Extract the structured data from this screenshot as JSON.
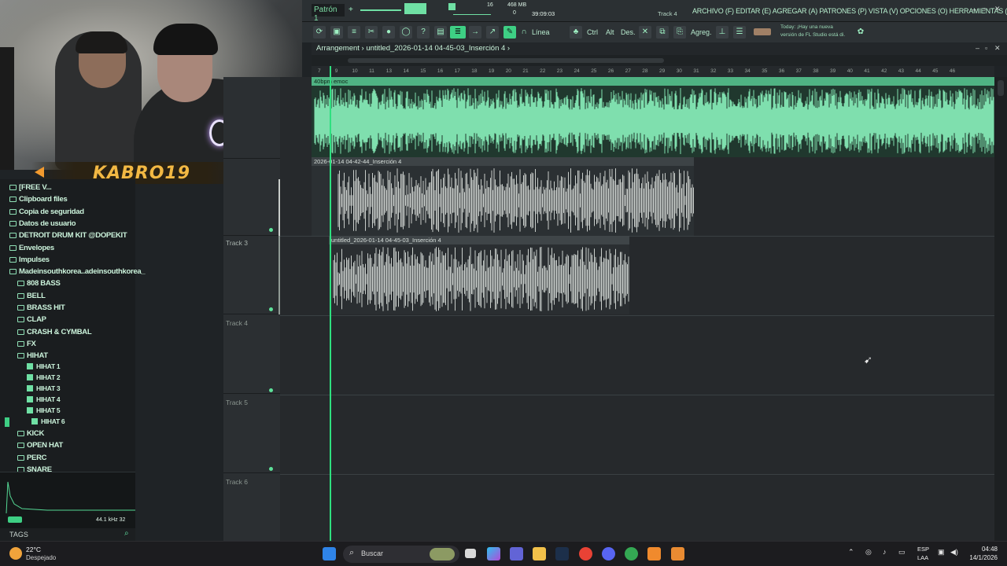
{
  "stream": {
    "name": "KABRO19"
  },
  "fl": {
    "pattern": "Patrón 1",
    "cpu_top": "16",
    "memory": "468 MB",
    "cpu_bottom": "0",
    "time": "39:09:03",
    "hint": "Track 4",
    "menu": "ARCHIVO (F) EDITAR (E) AGREGAR (A) PATRONES (P) VISTA (V) OPCIONES (O) HERRAMIENTAS (T) AYUDA",
    "line_mode": "Línea",
    "tools": [
      "Ctrl",
      "Alt",
      "Des.",
      "Agreg."
    ],
    "news_line1": "Today: ¡Hay una nueva",
    "news_line2": "versión de FL Studio está di.",
    "arrangement_title": "Arrangement › untitled_2026-01-14 04-45-03_Inserción 4 ›"
  },
  "ruler_ticks": [
    "7",
    "9",
    "10",
    "11",
    "13",
    "14",
    "15",
    "16",
    "17",
    "18",
    "19",
    "20",
    "21",
    "22",
    "23",
    "24",
    "25",
    "26",
    "27",
    "28",
    "29",
    "30",
    "31",
    "32",
    "33",
    "34",
    "35",
    "36",
    "37",
    "38",
    "39",
    "40",
    "41",
    "42",
    "43",
    "44",
    "45",
    "46"
  ],
  "clips": {
    "top_label": "40bpm emoc",
    "clip2_label": "2026-01-14 04-42-44_Inserción 4",
    "clip3_label": "untitled_2026-01-14 04-45-03_Inserción 4"
  },
  "tracks": [
    "Track 3",
    "Track 4",
    "Track 5",
    "Track 6"
  ],
  "browser": {
    "items": [
      {
        "label": "[FREE V...",
        "type": "folder"
      },
      {
        "label": "Clipboard files",
        "type": "folder"
      },
      {
        "label": "Copia de seguridad",
        "type": "folder"
      },
      {
        "label": "Datos de usuario",
        "type": "user"
      },
      {
        "label": "DETROIT DRUM KIT @DOPEKIT",
        "type": "folder"
      },
      {
        "label": "Envelopes",
        "type": "folder"
      },
      {
        "label": "Impulses",
        "type": "folder"
      },
      {
        "label": "Madeinsouthkorea..adeinsouthkorea_",
        "type": "folder"
      },
      {
        "label": "808 BASS",
        "type": "folder"
      },
      {
        "label": "BELL",
        "type": "folder"
      },
      {
        "label": "BRASS HIT",
        "type": "folder"
      },
      {
        "label": "CLAP",
        "type": "folder"
      },
      {
        "label": "CRASH & CYMBAL",
        "type": "folder"
      },
      {
        "label": "FX",
        "type": "folder"
      },
      {
        "label": "HIHAT",
        "type": "folder"
      },
      {
        "label": "HIHAT 1",
        "type": "wav"
      },
      {
        "label": "HIHAT 2",
        "type": "wav"
      },
      {
        "label": "HIHAT 3",
        "type": "wav"
      },
      {
        "label": "HIHAT 4",
        "type": "wav"
      },
      {
        "label": "HIHAT 5",
        "type": "wav"
      },
      {
        "label": "HIHAT 6",
        "type": "wav"
      },
      {
        "label": "KICK",
        "type": "folder"
      },
      {
        "label": "OPEN HAT",
        "type": "folder"
      },
      {
        "label": "PERC",
        "type": "folder"
      },
      {
        "label": "SNARE",
        "type": "folder"
      }
    ],
    "sample_rate": "44.1 kHz 32",
    "tags": "TAGS"
  },
  "taskbar": {
    "temp": "22°C",
    "weather": "Despejado",
    "search": "Buscar",
    "lang1": "ESP",
    "lang2": "LAA",
    "clock": "04:48",
    "date": "14/1/2026"
  },
  "colors": {
    "accent": "#5fe3a1",
    "wave_top": "#7fdfae",
    "wave_clip": "#c8cdca",
    "streamer": "#f2b843"
  }
}
